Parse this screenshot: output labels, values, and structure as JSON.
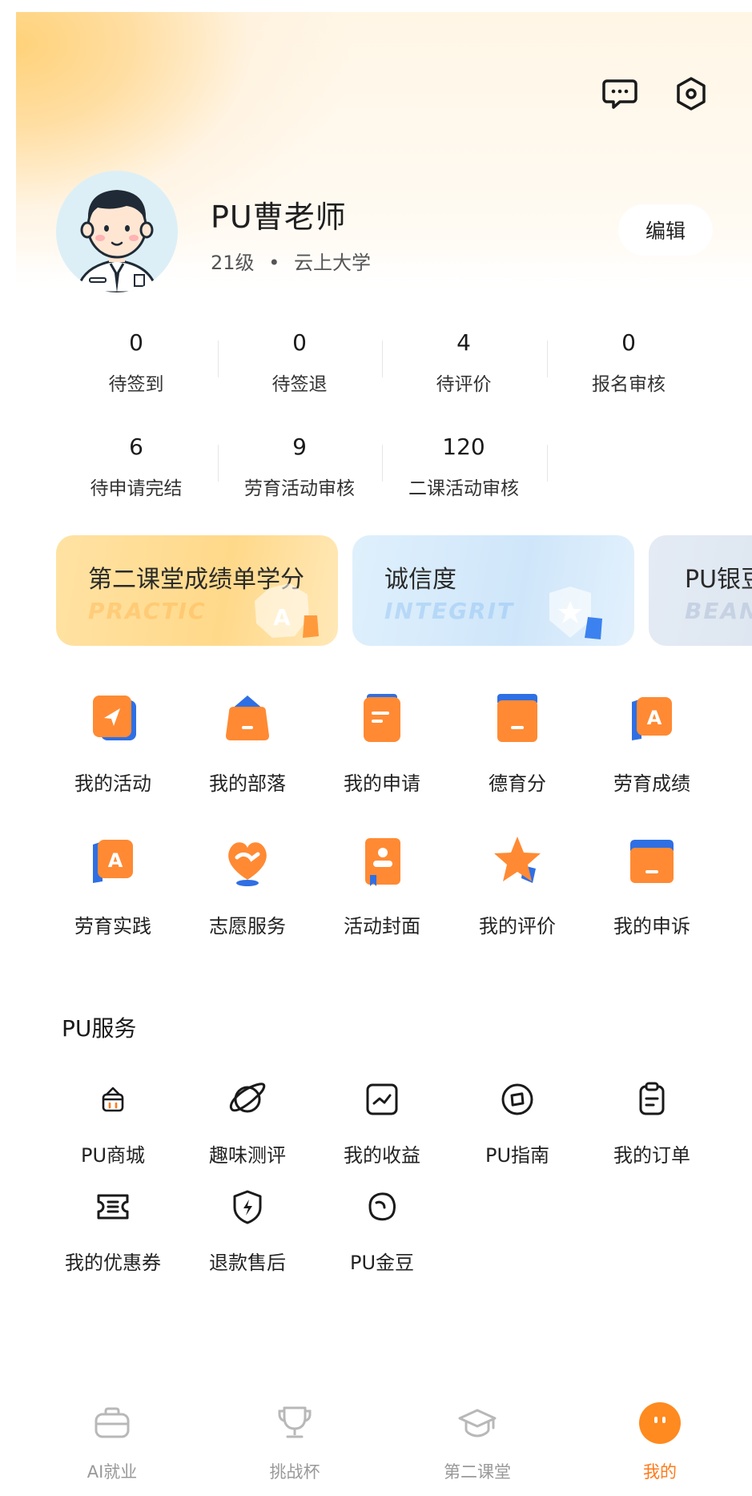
{
  "header": {
    "message_icon": "chat-bubble-icon",
    "settings_icon": "hexagon-gear-icon"
  },
  "profile": {
    "name": "PU曹老师",
    "grade": "21级",
    "separator": "•",
    "school": "云上大学",
    "edit_label": "编辑"
  },
  "stats": [
    {
      "value": "0",
      "label": "待签到"
    },
    {
      "value": "0",
      "label": "待签退"
    },
    {
      "value": "4",
      "label": "待评价"
    },
    {
      "value": "0",
      "label": "报名审核"
    },
    {
      "value": "6",
      "label": "待申请完结"
    },
    {
      "value": "9",
      "label": "劳育活动审核"
    },
    {
      "value": "120",
      "label": "二课活动审核"
    }
  ],
  "cards": [
    {
      "title": "第二课堂成绩单学分",
      "watermark": "PRACTIC",
      "color": "#ffd98a"
    },
    {
      "title": "诚信度",
      "watermark": "INTEGRIT",
      "color": "#d6ecfb"
    },
    {
      "title": "PU银豆",
      "watermark": "BEAN",
      "color": "#dde6f0"
    }
  ],
  "grid": [
    {
      "label": "我的活动",
      "icon": "send-activity-icon"
    },
    {
      "label": "我的部落",
      "icon": "tribe-icon"
    },
    {
      "label": "我的申请",
      "icon": "application-doc-icon"
    },
    {
      "label": "德育分",
      "icon": "moral-score-icon"
    },
    {
      "label": "劳育成绩",
      "icon": "labor-grade-icon"
    },
    {
      "label": "劳育实践",
      "icon": "labor-practice-icon"
    },
    {
      "label": "志愿服务",
      "icon": "volunteer-heart-icon"
    },
    {
      "label": "活动封面",
      "icon": "activity-cover-icon"
    },
    {
      "label": "我的评价",
      "icon": "star-review-icon"
    },
    {
      "label": "我的申诉",
      "icon": "appeal-envelope-icon"
    }
  ],
  "services": {
    "title": "PU服务",
    "items": [
      {
        "label": "PU商城",
        "icon": "shop-basket-icon"
      },
      {
        "label": "趣味测评",
        "icon": "planet-icon"
      },
      {
        "label": "我的收益",
        "icon": "income-chart-icon"
      },
      {
        "label": "PU指南",
        "icon": "compass-icon"
      },
      {
        "label": "我的订单",
        "icon": "clipboard-icon"
      },
      {
        "label": "我的优惠券",
        "icon": "coupon-icon"
      },
      {
        "label": "退款售后",
        "icon": "shield-bolt-icon"
      },
      {
        "label": "PU金豆",
        "icon": "bean-icon"
      }
    ]
  },
  "tabbar": [
    {
      "label": "AI就业",
      "icon": "briefcase-icon",
      "active": false
    },
    {
      "label": "挑战杯",
      "icon": "trophy-icon",
      "active": false
    },
    {
      "label": "第二课堂",
      "icon": "graduation-cap-icon",
      "active": false
    },
    {
      "label": "我的",
      "icon": "smiley-face-icon",
      "active": true
    }
  ],
  "colors": {
    "accent": "#ff7a1a",
    "icon_orange": "#ff8a33",
    "icon_blue": "#2f6fe4"
  }
}
